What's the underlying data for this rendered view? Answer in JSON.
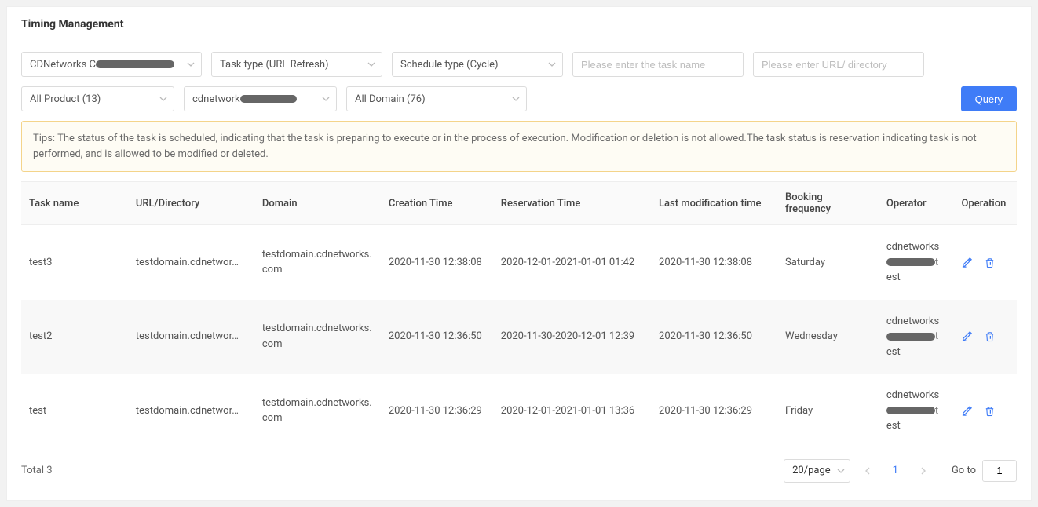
{
  "title": "Timing Management",
  "filters": {
    "customer": "CDNetworks C",
    "task_type": "Task type (URL Refresh)",
    "schedule_type": "Schedule type (Cycle)",
    "task_name_placeholder": "Please enter the task name",
    "url_placeholder": "Please enter URL/ directory",
    "product": "All Product (13)",
    "user": "cdnetwork",
    "domain": "All Domain (76)",
    "query_label": "Query"
  },
  "tips_label": "Tips:",
  "tips_text": "The status of the task is scheduled, indicating that the task is preparing to execute or in the process of execution. Modification or deletion is not allowed.The task status is reservation indicating task is not performed, and is allowed to be modified or deleted.",
  "columns": {
    "task_name": "Task name",
    "url": "URL/Directory",
    "domain": "Domain",
    "creation": "Creation Time",
    "reservation": "Reservation Time",
    "last_mod": "Last modification time",
    "booking": "Booking frequency",
    "operator": "Operator",
    "operation": "Operation"
  },
  "rows": [
    {
      "task_name": "test3",
      "url": "testdomain.cdnetwor…",
      "domain": "testdomain.cdnetworks.com",
      "creation": "2020-11-30 12:38:08",
      "reservation": "2020-12-01-2021-01-01 01:42",
      "last_mod": "2020-11-30 12:38:08",
      "booking": "Saturday",
      "operator_prefix": "cdnetworks",
      "operator_suffix": "est"
    },
    {
      "task_name": "test2",
      "url": "testdomain.cdnetwor…",
      "domain": "testdomain.cdnetworks.com",
      "creation": "2020-11-30 12:36:50",
      "reservation": "2020-11-30-2020-12-01 12:39",
      "last_mod": "2020-11-30 12:36:50",
      "booking": "Wednesday",
      "operator_prefix": "cdnetworks",
      "operator_suffix": "est"
    },
    {
      "task_name": "test",
      "url": "testdomain.cdnetwor…",
      "domain": "testdomain.cdnetworks.com",
      "creation": "2020-11-30 12:36:29",
      "reservation": "2020-12-01-2021-01-01 13:36",
      "last_mod": "2020-11-30 12:36:29",
      "booking": "Friday",
      "operator_prefix": "cdnetworks",
      "operator_suffix": "est"
    }
  ],
  "pagination": {
    "total": "Total 3",
    "page_size": "20/page",
    "current": "1",
    "goto_label": "Go to",
    "goto_value": "1"
  }
}
